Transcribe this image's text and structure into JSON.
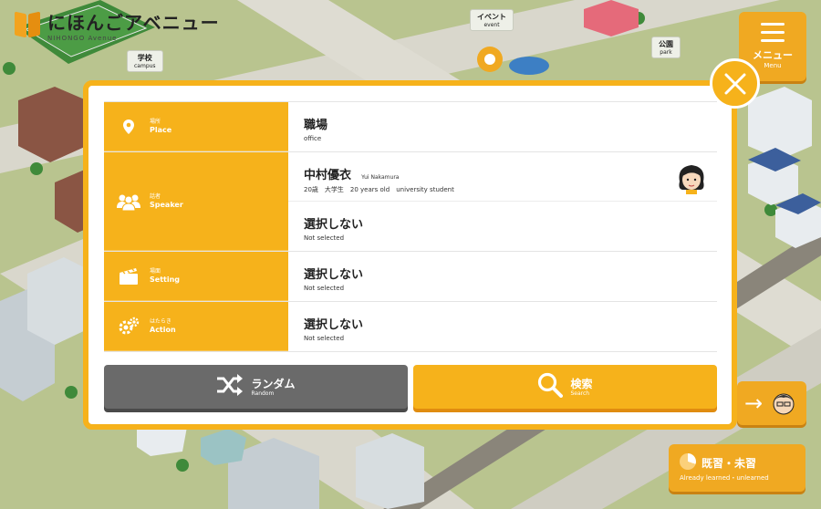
{
  "app": {
    "logo_text": "にほんごアベニュー",
    "logo_sub": "NIHONGO Avenue"
  },
  "map_labels": [
    {
      "jp": "学校",
      "en": "campus"
    },
    {
      "jp": "イベント",
      "en": "event"
    },
    {
      "jp": "公園",
      "en": "park"
    }
  ],
  "menu": {
    "label": "メニュー",
    "en": "Menu"
  },
  "learned": {
    "label": "既習・未習",
    "en": "Already learned・unlearned"
  },
  "colors": {
    "accent": "#f6b21b",
    "random_button": "#6a6a6a",
    "map_bg": "#b9c48f"
  },
  "filters": {
    "place": {
      "label_jp": "場所",
      "label_en": "Place",
      "icon": "location-pin-icon",
      "value": "職場",
      "value_en": "office"
    },
    "speaker": {
      "label_jp": "話者",
      "label_en": "Speaker",
      "icon": "people-icon",
      "entries": [
        {
          "name": "中村優衣",
          "romaji": "Yui Nakamura",
          "detail": "20歳　大学生　20 years old　university student",
          "icon": "avatar-icon"
        },
        {
          "name": "選択しない",
          "detail": "Not selected"
        }
      ]
    },
    "setting": {
      "label_jp": "場面",
      "label_en": "Setting",
      "icon": "clapperboard-icon",
      "value": "選択しない",
      "value_en": "Not selected"
    },
    "action": {
      "label_jp": "はたらき",
      "label_en": "Action",
      "icon": "gears-icon",
      "value": "選択しない",
      "value_en": "Not selected"
    }
  },
  "buttons": {
    "random": {
      "label": "ランダム",
      "en": "Random",
      "icon": "shuffle-icon"
    },
    "search": {
      "label": "検索",
      "en": "Search",
      "icon": "magnifier-icon"
    }
  }
}
